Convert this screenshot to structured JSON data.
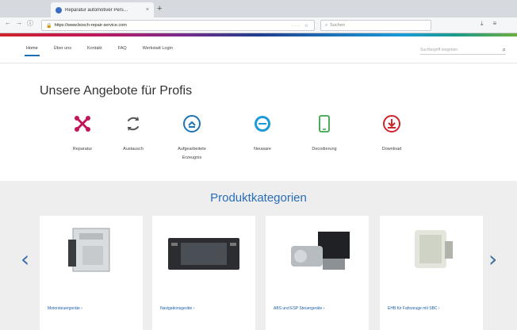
{
  "browser": {
    "tab_title": "Reparatur automotiver Pers…",
    "tab_close": "×",
    "new_tab": "+",
    "url": "https://www.bosch-repair-service.com",
    "url_actions": "··· ☆",
    "search_placeholder": "Suchen"
  },
  "nav": {
    "items": [
      "Home",
      "Über uns",
      "Kontakt",
      "FAQ",
      "Werkstatt Login"
    ],
    "search_placeholder": "Suchbegriff eingeben"
  },
  "offers": {
    "title": "Unsere Angebote für Profis",
    "items": [
      {
        "label": "Reparatur",
        "icon": "tools-icon",
        "color": "#c2185b"
      },
      {
        "label": "Austausch",
        "icon": "exchange-icon",
        "color": "#555555"
      },
      {
        "label": "Aufgearbeitete Erzeugnis",
        "icon": "remanufactured-icon",
        "color": "#1c74b9"
      },
      {
        "label": "Neuware",
        "icon": "new-product-icon",
        "color": "#1a9bd7"
      },
      {
        "label": "Decodierung",
        "icon": "phone-icon",
        "color": "#3aa34a"
      },
      {
        "label": "Download",
        "icon": "download-icon",
        "color": "#d0232c"
      }
    ]
  },
  "categories": {
    "title": "Produktkategorien",
    "items": [
      {
        "label": "Motorsteuergeräte  ›"
      },
      {
        "label": "Navigationsgeräte  ›"
      },
      {
        "label": "ABS und ESP Steuergeräte  ›"
      },
      {
        "label": "EHB für Fahrzeuge mit SBC  ›"
      }
    ]
  },
  "colors": {
    "accent": "#1b6fb5",
    "category_title": "#2a6db8",
    "gray_bg": "#eeeeee"
  }
}
